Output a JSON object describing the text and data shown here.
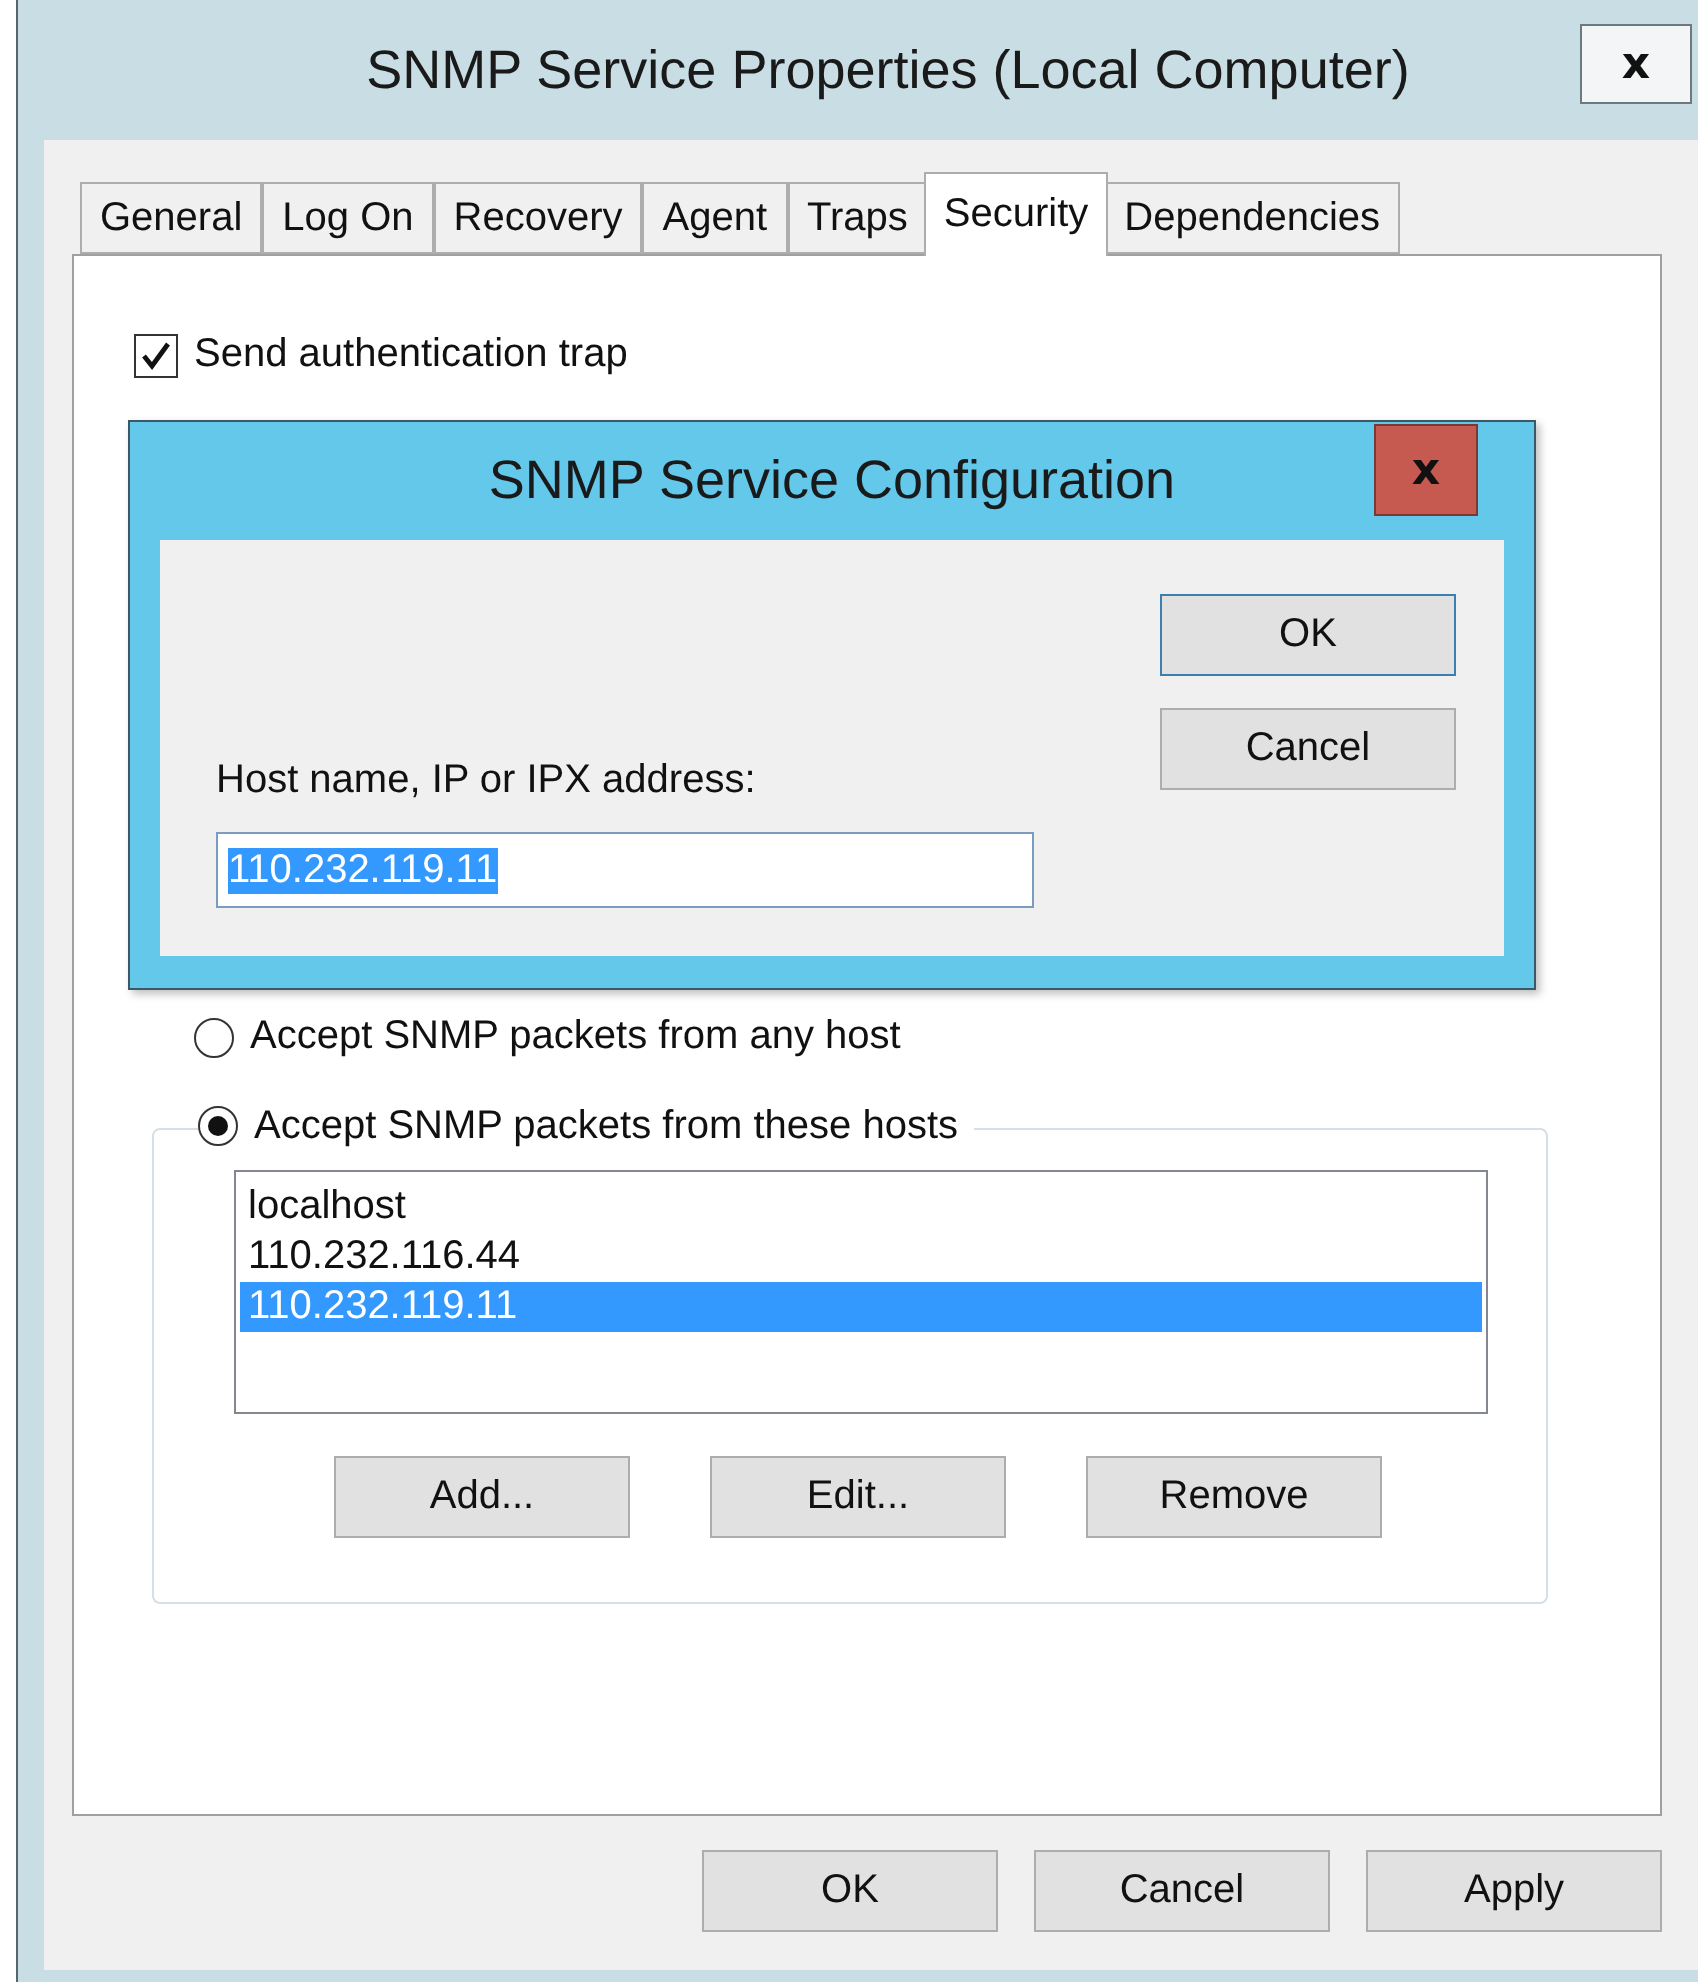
{
  "window": {
    "title": "SNMP Service Properties (Local Computer)",
    "close": "x"
  },
  "tabs": [
    {
      "label": "General",
      "selected": false
    },
    {
      "label": "Log On",
      "selected": false
    },
    {
      "label": "Recovery",
      "selected": false
    },
    {
      "label": "Agent",
      "selected": false
    },
    {
      "label": "Traps",
      "selected": false
    },
    {
      "label": "Security",
      "selected": true
    },
    {
      "label": "Dependencies",
      "selected": false
    }
  ],
  "send_auth_trap": {
    "label": "Send authentication trap",
    "checked": true
  },
  "accept_options": [
    {
      "label": "Accept SNMP packets from any host",
      "selected": false
    },
    {
      "label": "Accept SNMP packets from these hosts",
      "selected": true
    }
  ],
  "hosts": [
    {
      "text": "localhost",
      "selected": false
    },
    {
      "text": "110.232.116.44",
      "selected": false
    },
    {
      "text": "110.232.119.11",
      "selected": true
    }
  ],
  "host_buttons": [
    "Add...",
    "Edit...",
    "Remove"
  ],
  "buttons": [
    "OK",
    "Cancel",
    "Apply"
  ],
  "config_dialog": {
    "title": "SNMP Service Configuration",
    "close": "x",
    "buttons": [
      "OK",
      "Cancel"
    ],
    "field_label": "Host name, IP or IPX address:",
    "field_value": "110.232.119.11",
    "value_selected": true
  }
}
